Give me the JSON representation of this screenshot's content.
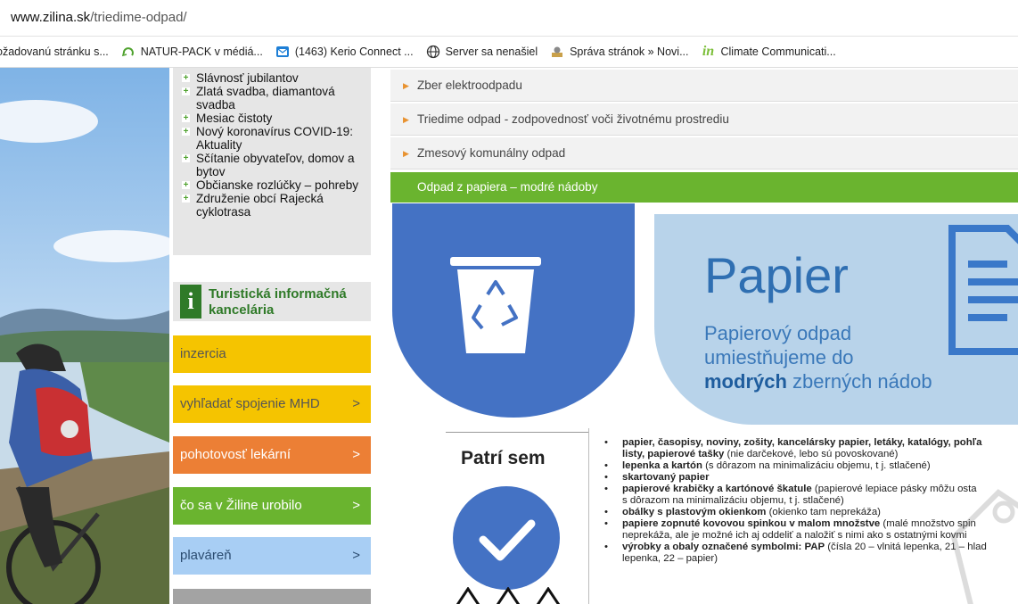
{
  "browser": {
    "url_domain": "www.zilina.sk",
    "url_path": "/triedime-odpad/",
    "bookmarks": [
      {
        "label": "ožadovanú stránku s...",
        "icon": "page-icon"
      },
      {
        "label": "NATUR-PACK v médiá...",
        "icon": "naturpack-icon"
      },
      {
        "label": "(1463) Kerio Connect ...",
        "icon": "mail-icon"
      },
      {
        "label": "Server sa nenašiel",
        "icon": "globe-icon"
      },
      {
        "label": "Správa stránok » Novi...",
        "icon": "admin-icon"
      },
      {
        "label": "Climate Communicati...",
        "icon": "in-icon"
      }
    ]
  },
  "sidebar": {
    "menu_items": [
      "Slávnosť jubilantov",
      "Zlatá svadba, diamantová svadba",
      "Mesiac čistoty",
      "Nový koronavírus COVID-19: Aktuality",
      "Sčítanie obyvateľov, domov a bytov",
      "Občianske rozlúčky – pohreby",
      "Združenie obcí Rajecká cyklotrasa"
    ],
    "tik_line1": "Turistická informačná",
    "tik_line2": "kancelária",
    "buttons": {
      "inzercia": "inzercia",
      "mhd": "vyhľadať spojenie MHD",
      "lekarni": "pohotovosť lekární",
      "urobilo": "čo sa v Žiline urobilo",
      "plavaren": "plaváreň",
      "arrow": ">"
    },
    "colors": {
      "yellow": "#f5c400",
      "orange": "#ec7f35",
      "green": "#6ab42f",
      "lightblue": "#a8cef4"
    }
  },
  "accordion": {
    "items": [
      "Zber elektroodpadu",
      "Triedime odpad - zodpovednosť voči životnému prostrediu",
      "Zmesový komunálny odpad"
    ],
    "active": "Odpad z papiera – modré nádoby"
  },
  "hero": {
    "title": "Papier",
    "sub_line1": "Papierový odpad",
    "sub_line2": "umiestňujeme do",
    "sub_bold": "modrých",
    "sub_rest": "zberných nádob"
  },
  "patri": {
    "title": "Patrí sem",
    "items": [
      {
        "bold": "papier, časopisy, noviny, zošity, kancelársky papier, letáky, katalógy, pohľa",
        "rest": ""
      },
      {
        "bold": "listy, papierové tašky",
        "rest": " (nie darčekové, lebo sú povoskované)",
        "continuation": true
      },
      {
        "bold": "lepenka a kartón",
        "rest": " (s dôrazom na minimalizáciu objemu, t j. stlačené)"
      },
      {
        "bold": "skartovaný papier",
        "rest": ""
      },
      {
        "bold": "papierové krabičky a kartónové škatule",
        "rest": " (papierové lepiace pásky môžu osta"
      },
      {
        "bold": "",
        "rest": "s dôrazom na minimalizáciu objemu, t j. stlačené)",
        "continuation": true
      },
      {
        "bold": "obálky s plastovým okienkom",
        "rest": " (okienko tam neprekáža)"
      },
      {
        "bold": "papiere zopnuté kovovou spinkou v malom množstve",
        "rest": " (malé množstvo spin"
      },
      {
        "bold": "",
        "rest": "neprekáža, ale je možné ich aj oddeliť a naložiť s nimi ako s ostatnými kovmi",
        "continuation": true
      },
      {
        "bold": "výrobky a obaly označené symbolmi: PAP",
        "rest": " (čísla 20 – vlnitá lepenka, 21 – hlad"
      },
      {
        "bold": "",
        "rest": "lepenka, 22 – papier)",
        "continuation": true
      }
    ]
  },
  "colors": {
    "blue": "#4472c4",
    "panel": "#b8d3ea",
    "title_blue": "#2f6fb2"
  }
}
